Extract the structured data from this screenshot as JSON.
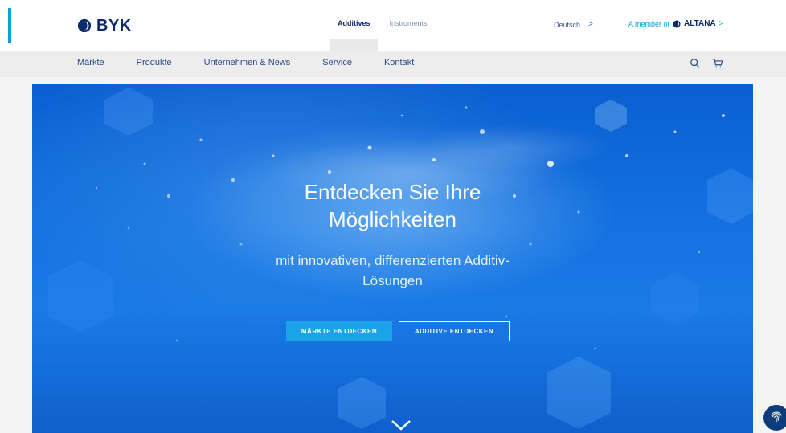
{
  "header": {
    "logo_text": "BYK",
    "site_tabs": [
      {
        "label": "Additives",
        "active": true
      },
      {
        "label": "Instruments",
        "active": false
      }
    ],
    "language": "Deutsch",
    "member_prefix": "A member of",
    "member_brand": "ALTANA"
  },
  "nav": {
    "items": [
      {
        "label": "Märkte"
      },
      {
        "label": "Produkte"
      },
      {
        "label": "Unternehmen & News"
      },
      {
        "label": "Service"
      },
      {
        "label": "Kontakt"
      }
    ],
    "icons": [
      "search-icon",
      "cart-icon"
    ]
  },
  "hero": {
    "title_line1": "Entdecken Sie Ihre",
    "title_line2": "Möglichkeiten",
    "subtitle_line1": "mit innovativen, differenzierten Additiv-",
    "subtitle_line2": "Lösungen",
    "primary_button": "MÄRKTE ENTDECKEN",
    "secondary_button": "ADDITIVE ENTDECKEN"
  },
  "colors": {
    "brand_navy": "#0d2a6b",
    "accent_cyan": "#0aa0dc",
    "hero_blue": "#1471e0",
    "button_primary": "#1aa3e8"
  }
}
